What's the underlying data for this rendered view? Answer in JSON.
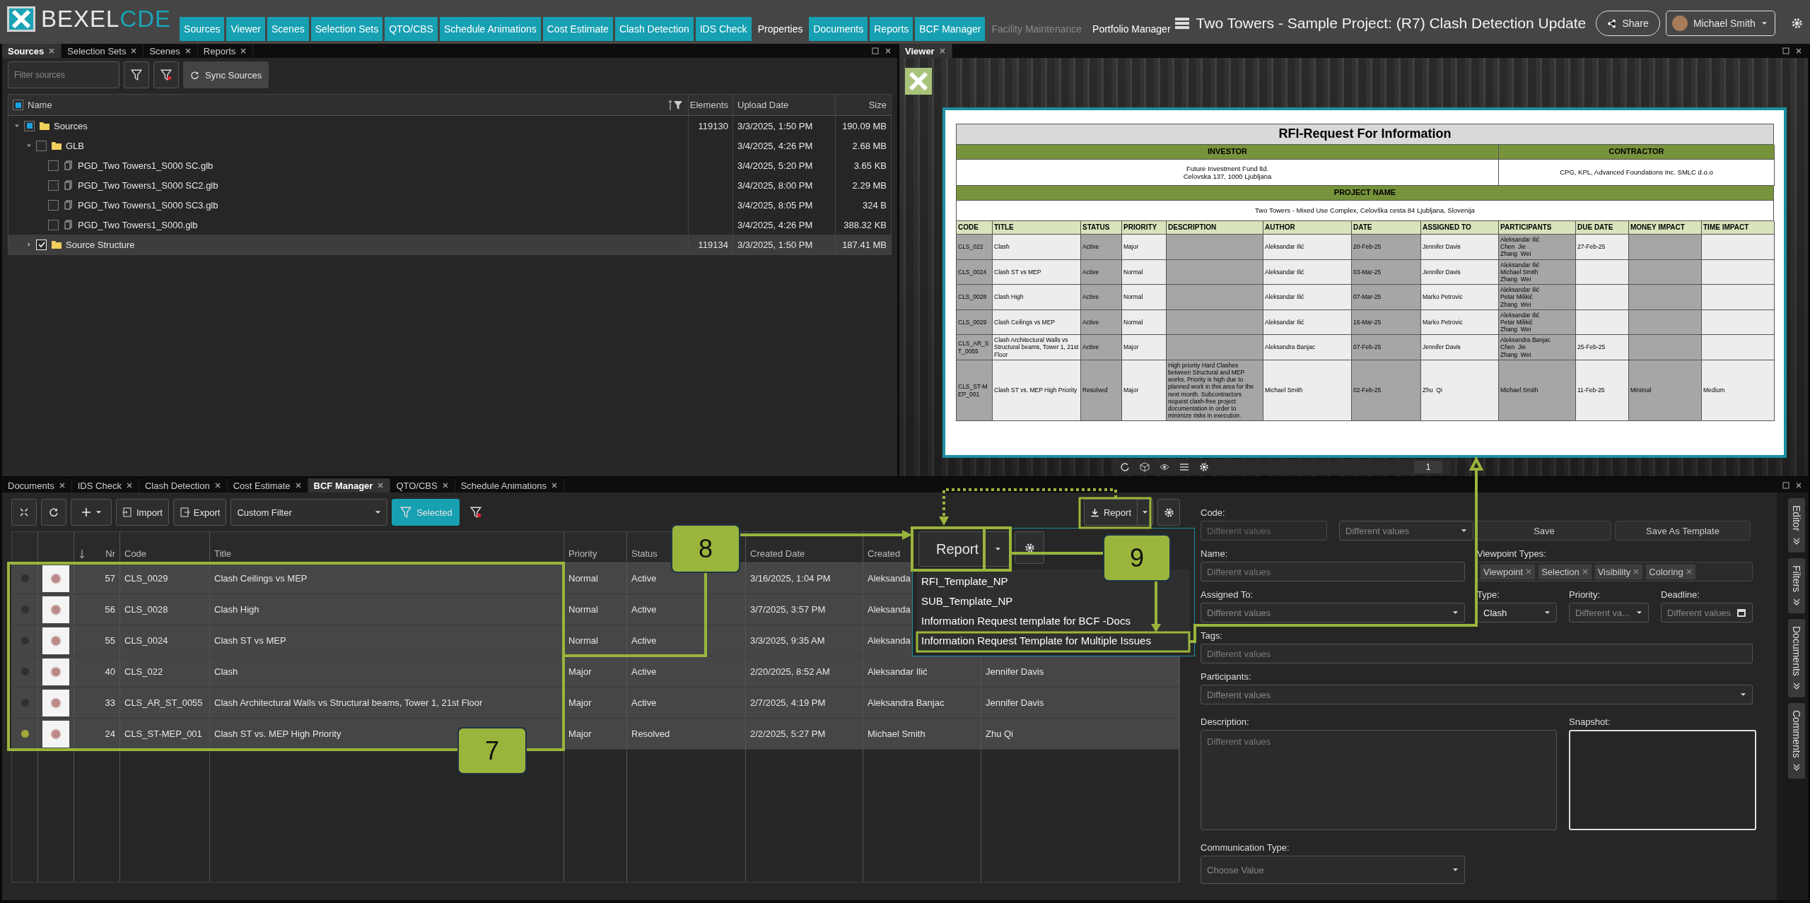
{
  "app": {
    "logo_main": "BEXEL",
    "logo_accent": "CDE"
  },
  "nav_tabs": [
    {
      "label": "Sources",
      "highlighted": true,
      "disabled": false
    },
    {
      "label": "Viewer",
      "highlighted": true,
      "disabled": false
    },
    {
      "label": "Scenes",
      "highlighted": true,
      "disabled": false
    },
    {
      "label": "Selection Sets",
      "highlighted": true,
      "disabled": false
    },
    {
      "label": "QTO/CBS",
      "highlighted": true,
      "disabled": false
    },
    {
      "label": "Schedule Animations",
      "highlighted": true,
      "disabled": false
    },
    {
      "label": "Cost Estimate",
      "highlighted": true,
      "disabled": false
    },
    {
      "label": "Clash Detection",
      "highlighted": true,
      "disabled": false
    },
    {
      "label": "IDS Check",
      "highlighted": true,
      "disabled": false
    },
    {
      "label": "Properties",
      "highlighted": false,
      "disabled": false
    },
    {
      "label": "Documents",
      "highlighted": true,
      "disabled": false
    },
    {
      "label": "Reports",
      "highlighted": true,
      "disabled": false
    },
    {
      "label": "BCF Manager",
      "highlighted": true,
      "disabled": false
    },
    {
      "label": "Facility Maintenance",
      "highlighted": false,
      "disabled": true
    },
    {
      "label": "Portfolio Manager",
      "highlighted": false,
      "disabled": false
    }
  ],
  "project_title": "Two Towers - Sample Project: (R7) Clash Detection Update",
  "share_button": "Share",
  "user": {
    "name": "Michael Smith"
  },
  "sources_panel": {
    "tabs": [
      {
        "label": "Sources",
        "selected": true
      },
      {
        "label": "Selection Sets",
        "selected": false
      },
      {
        "label": "Scenes",
        "selected": false
      },
      {
        "label": "Reports",
        "selected": false
      }
    ],
    "filter": {
      "placeholder": "Filter sources"
    },
    "sync_button": "Sync Sources",
    "header_checkbox": {
      "checked": false,
      "indeterminate": true
    },
    "columns": [
      "Name",
      "Elements",
      "Upload Date",
      "Size"
    ],
    "tree": [
      {
        "kind": "folder",
        "name": "Sources",
        "expanded": true,
        "checked": false,
        "indeterminate": true,
        "selected": false,
        "elements": "119130",
        "date": "3/3/2025, 1:50 PM",
        "size": "190.09 MB",
        "children": [
          {
            "kind": "folder",
            "name": "GLB",
            "expanded": true,
            "checked": false,
            "indeterminate": false,
            "selected": false,
            "date": "3/4/2025, 4:26 PM",
            "size": "2.68 MB",
            "children": [
              {
                "kind": "file",
                "name": "PGD_Two Towers1_S000 SC.glb",
                "checked": false,
                "indeterminate": false,
                "selected": false,
                "date": "3/4/2025, 5:20 PM",
                "size": "3.65 KB"
              },
              {
                "kind": "file",
                "name": "PGD_Two Towers1_S000 SC2.glb",
                "checked": false,
                "indeterminate": false,
                "selected": false,
                "date": "3/4/2025, 8:00 PM",
                "size": "2.29 MB"
              },
              {
                "kind": "file",
                "name": "PGD_Two Towers1_S000 SC3.glb",
                "checked": false,
                "indeterminate": false,
                "selected": false,
                "date": "3/4/2025, 8:05 PM",
                "size": "324 B"
              },
              {
                "kind": "file",
                "name": "PGD_Two Towers1_S000.glb",
                "checked": false,
                "indeterminate": false,
                "selected": false,
                "date": "3/4/2025, 4:26 PM",
                "size": "388.32 KB"
              }
            ]
          },
          {
            "kind": "folder",
            "name": "Source Structure",
            "expanded": false,
            "checked": true,
            "indeterminate": false,
            "selected": true,
            "elements": "119134",
            "date": "3/3/2025, 1:50 PM",
            "size": "187.41 MB"
          }
        ]
      }
    ]
  },
  "viewer": {
    "tab": "Viewer",
    "page": "1",
    "rfi": {
      "title": "RFI-Request For Information",
      "investor_label": "INVESTOR",
      "contractor_label": "CONTRACTOR",
      "investor": "Future Investment Fund ltd.\nCelovska 137, 1000 Ljubljana",
      "contractor": "CPG, KPL, Advanced Foundations Inc. SMLC d.o.o",
      "project_label": "PROJECT NAME",
      "project": "Two Towers - Mixed Use Complex, Celovška cesta 84 Ljubljana, Slovenija",
      "columns": [
        "CODE",
        "TITLE",
        "STATUS",
        "PRIORITY",
        "DESCRIPTION",
        "AUTHOR",
        "DATE",
        "ASSIGNED TO",
        "PARTICIPANTS",
        "DUE DATE",
        "MONEY IMPACT",
        "TIME IMPACT"
      ],
      "rows": [
        {
          "code": "CLS_022",
          "title": "Clash",
          "status": "Active",
          "priority": "Major",
          "author": "Aleksandar Ilić",
          "date": "20-Feb-25",
          "assigned_to": "Jennifer Davis",
          "participants": "Aleksandar Ilić\nChen  Jie\nZhang  Wei",
          "due_date": "27-Feb-25"
        },
        {
          "code": "CLS_0024",
          "title": "Clash ST vs MEP",
          "status": "Active",
          "priority": "Normal",
          "author": "Aleksandar Ilić",
          "date": "03-Mar-25",
          "assigned_to": "Jennifer Davis",
          "participants": "Aleksandar Ilić\nMichael Smith\nZhang  Wei"
        },
        {
          "code": "CLS_0028",
          "title": "Clash High",
          "status": "Active",
          "priority": "Normal",
          "author": "Aleksandar Ilić",
          "date": "07-Mar-25",
          "assigned_to": "Marko Petrovic",
          "participants": "Aleksandar Ilić\nPetar Milikić\nZhang  Wei"
        },
        {
          "code": "CLS_0029",
          "title": "Clash Ceilings vs MEP",
          "status": "Active",
          "priority": "Normal",
          "author": "Aleksandar Ilić",
          "date": "16-Mar-25",
          "assigned_to": "Marko Petrovic",
          "participants": "Aleksandar Ilić\nPetar Milikić\nZhang  Wei"
        },
        {
          "code": "CLS_AR_ST_0055",
          "title": "Clash Architectural Walls vs Structural beams, Tower 1, 21st Floor",
          "status": "Active",
          "priority": "Major",
          "author": "Aleksandra Banjac",
          "date": "07-Feb-25",
          "assigned_to": "Jennifer Davis",
          "participants": "Aleksandra Banjac\nChen  Jie\nZhang  Wei",
          "due_date": "25-Feb-25"
        },
        {
          "code": "CLS_ST-MEP_001",
          "title": "Clash ST vs. MEP High Priority",
          "status": "Resolved",
          "priority": "Major",
          "description": "High priority Hard Clashes between Structural and MEP works. Priority is high due to planned work in this area for the next month. Subcontractors request clash-free project documentation in order to minimize risks in execution.",
          "author": "Michael Smith",
          "date": "02-Feb-25",
          "assigned_to": "Zhu  Qi",
          "participants": "Michael Smith",
          "due_date": "11-Feb-25",
          "money_impact": "Minimal",
          "time_impact": "Medium"
        }
      ]
    }
  },
  "bcf_panel": {
    "tabs": [
      {
        "label": "Documents",
        "selected": false
      },
      {
        "label": "IDS Check",
        "selected": false
      },
      {
        "label": "Clash Detection",
        "selected": false
      },
      {
        "label": "Cost Estimate",
        "selected": false
      },
      {
        "label": "BCF Manager",
        "selected": true
      },
      {
        "label": "QTO/CBS",
        "selected": false
      },
      {
        "label": "Schedule Animations",
        "selected": false
      }
    ],
    "toolbar": {
      "import": "Import",
      "export": "Export",
      "filter": "Custom Filter",
      "selected_button": "Selected",
      "report": "Report"
    },
    "columns": [
      "Nr",
      "Code",
      "Title",
      "Priority",
      "Status",
      "Created Date",
      "Created"
    ],
    "rows": [
      {
        "color": "#303030",
        "nr": "57",
        "code": "CLS_0029",
        "title": "Clash Ceilings vs MEP",
        "priority": "Normal",
        "status": "Active",
        "created": "3/16/2025, 1:04 PM",
        "created_by": "Aleksanda"
      },
      {
        "color": "#303030",
        "nr": "56",
        "code": "CLS_0028",
        "title": "Clash High",
        "priority": "Normal",
        "status": "Active",
        "created": "3/7/2025, 3:57 PM",
        "created_by": "Aleksanda"
      },
      {
        "color": "#303030",
        "nr": "55",
        "code": "CLS_0024",
        "title": "Clash ST vs MEP",
        "priority": "Normal",
        "status": "Active",
        "created": "3/3/2025, 9:35 AM",
        "created_by": "Aleksanda"
      },
      {
        "color": "#303030",
        "nr": "40",
        "code": "CLS_022",
        "title": "Clash",
        "priority": "Major",
        "status": "Active",
        "created": "2/20/2025, 8:52 AM",
        "created_by": "Aleksandar Ilić",
        "assigned_to": "Jennifer Davis"
      },
      {
        "color": "#303030",
        "nr": "33",
        "code": "CLS_AR_ST_0055",
        "title": "Clash Architectural Walls vs Structural beams, Tower 1, 21st Floor",
        "priority": "Major",
        "status": "Active",
        "created": "2/7/2025, 4:19 PM",
        "created_by": "Aleksandra Banjac",
        "assigned_to": "Jennifer Davis"
      },
      {
        "color": "#a3a83a",
        "nr": "24",
        "code": "CLS_ST-MEP_001",
        "title": "Clash ST vs. MEP High Priority",
        "priority": "Major",
        "status": "Resolved",
        "created": "2/2/2025, 5:27 PM",
        "created_by": "Michael Smith",
        "assigned_to": "Zhu Qi"
      }
    ],
    "report_menu": {
      "button": "Report",
      "items": [
        "RFI_Template_NP",
        "SUB_Template_NP",
        "Information Request template for BCF -Docs",
        "Information Request Template for Multiple Issues"
      ]
    }
  },
  "editor": {
    "code_label": "Code:",
    "code_placeholder": "Different values",
    "code_select": "Different values",
    "save": "Save",
    "save_template": "Save As Template",
    "name_label": "Name:",
    "name_placeholder": "Different values",
    "viewpoint_label": "Viewpoint Types:",
    "viewpoint_types": [
      "Viewpoint",
      "Selection",
      "Visibility",
      "Coloring"
    ],
    "assigned_label": "Assigned To:",
    "assigned_placeholder": "Different values",
    "type_label": "Type:",
    "type_value": "Clash",
    "priority_label": "Priority:",
    "priority_placeholder": "Different va...",
    "deadline_label": "Deadline:",
    "deadline_placeholder": "Different values",
    "tags_label": "Tags:",
    "tags_placeholder": "Different values",
    "participants_label": "Participants:",
    "participants_placeholder": "Different values",
    "description_label": "Description:",
    "description_placeholder": "Different values",
    "snapshot_label": "Snapshot:",
    "communication_label": "Communication Type:",
    "communication_placeholder": "Choose Value"
  },
  "side_tabs": [
    "Editor",
    "Filters",
    "Documents",
    "Comments"
  ],
  "annotations": {
    "callouts": [
      "8",
      "9",
      "7"
    ]
  }
}
